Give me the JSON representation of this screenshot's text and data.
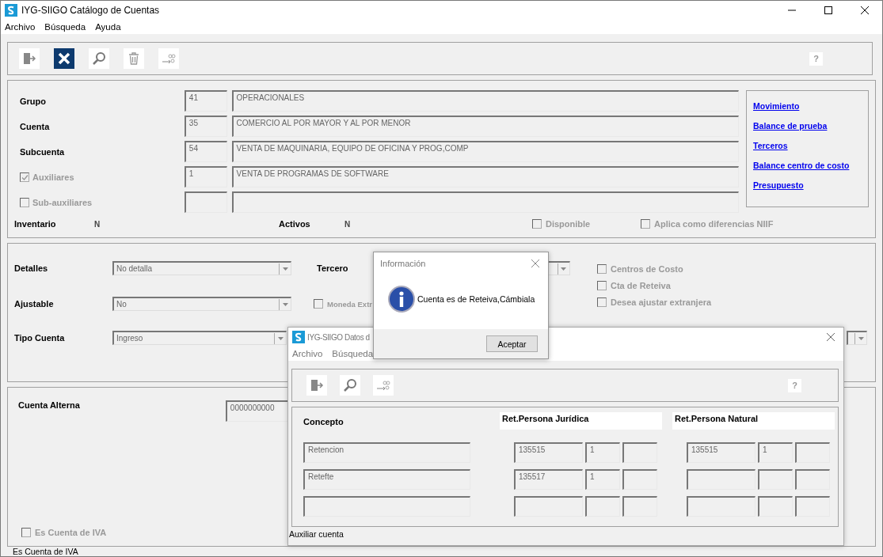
{
  "window": {
    "title": "IYG-SIIGO  Catálogo de Cuentas"
  },
  "menu": [
    "Archivo",
    "Búsqueda",
    "Ayuda"
  ],
  "toolbar": {
    "help": "?"
  },
  "account_levels": [
    {
      "kind": "label",
      "label": "Grupo",
      "code": "41",
      "description": "OPERACIONALES"
    },
    {
      "kind": "label",
      "label": "Cuenta",
      "code": "35",
      "description": "COMERCIO AL POR MAYOR Y AL  POR MENOR"
    },
    {
      "kind": "label",
      "label": "Subcuenta",
      "code": "54",
      "description": "VENTA DE MAQUINARIA, EQUIPO DE OFICINA Y PROG,COMP"
    },
    {
      "kind": "checkbox",
      "label": "Auxiliares",
      "checked": true,
      "disabled": true,
      "code": "1",
      "description": "VENTA DE PROGRAMAS DE SOFTWARE"
    },
    {
      "kind": "checkbox",
      "label": "Sub-auxiliares",
      "checked": false,
      "disabled": true
    }
  ],
  "links": [
    "Movimiento",
    "Balance de prueba",
    "Terceros",
    "Balance centro de costo",
    "Presupuesto"
  ],
  "flags": [
    {
      "label": "Inventario",
      "value": "N"
    },
    {
      "label": "Activos",
      "value": "N"
    }
  ],
  "options": [
    {
      "label": "Disponible",
      "checked": false,
      "disabled": true
    },
    {
      "label": "Aplica como diferencias NIIF",
      "checked": false,
      "disabled": true
    }
  ],
  "settings": {
    "selects": [
      {
        "label": "Detalles",
        "value": "No detalla"
      },
      {
        "label": "Ajustable",
        "value": "No"
      },
      {
        "label": "Tipo Cuenta",
        "value": "Ingreso"
      }
    ],
    "tercero": {
      "label": "Tercero"
    },
    "moneda": {
      "label": "Moneda Extr",
      "checked": false,
      "disabled": true
    },
    "checks": [
      {
        "label": "Centros de Costo",
        "checked": false,
        "disabled": true
      },
      {
        "label": "Cta de Reteiva",
        "checked": false,
        "disabled": true
      },
      {
        "label": "Desea ajustar extranjera",
        "checked": false,
        "disabled": true
      }
    ]
  },
  "alternate": {
    "label": "Cuenta Alterna",
    "value": "0000000000",
    "iva": {
      "label": "Es Cuenta de IVA",
      "checked": false,
      "disabled": true
    }
  },
  "status_bar": "Es Cuenta de IVA",
  "child_window": {
    "title": "IYG-SIIGO Datos d",
    "menu": [
      "Archivo",
      "Búsqueda"
    ],
    "help": "?",
    "columns": [
      "Concepto",
      "Ret.Persona Jurídica",
      "Ret.Persona Natural"
    ],
    "rows": [
      {
        "concepto": "Retencion",
        "juridica": [
          "135515",
          "1"
        ],
        "natural": [
          "135515",
          "1"
        ]
      },
      {
        "concepto": "Retefte",
        "juridica": [
          "135517",
          "1"
        ]
      }
    ],
    "status": "Auxiliar cuenta"
  },
  "dialog": {
    "title": "Información",
    "message": "Cuenta es de Reteiva,Cámbiala",
    "button": "Aceptar"
  }
}
